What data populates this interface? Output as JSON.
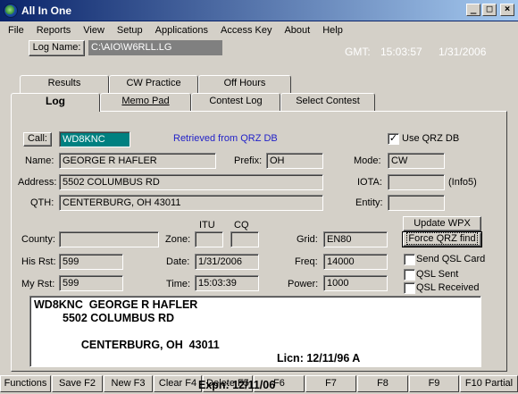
{
  "window": {
    "title": "All In One"
  },
  "menu": [
    "File",
    "Reports",
    "View",
    "Setup",
    "Applications",
    "Access Key",
    "About",
    "Help"
  ],
  "header": {
    "logname_button": "Log Name:",
    "logname_value": "C:\\AIO\\W6RLL.LG",
    "gmt_label": "GMT:",
    "gmt_time": "15:03:57",
    "date": "1/31/2006"
  },
  "tabs_row1": [
    "Results",
    "CW Practice",
    "Off Hours"
  ],
  "tabs_row2": [
    "Log",
    "Memo Pad",
    "Contest Log",
    "Select Contest"
  ],
  "form": {
    "call_button": "Call:",
    "call": "WD8KNC",
    "retrieved": "Retrieved from QRZ DB",
    "use_qrz_label": "Use QRZ DB",
    "use_qrz_checked": "✓",
    "name_label": "Name:",
    "name": "GEORGE R HAFLER",
    "prefix_label": "Prefix:",
    "prefix": "OH",
    "mode_label": "Mode:",
    "mode": "CW",
    "address_label": "Address:",
    "address": "5502 COLUMBUS RD",
    "iota_label": "IOTA:",
    "iota": "",
    "info5": "(Info5)",
    "qth_label": "QTH:",
    "qth": "CENTERBURG, OH  43011",
    "entity_label": "Entity:",
    "entity": "",
    "itu_label": "ITU",
    "cq_label": "CQ",
    "county_label": "County:",
    "county": "",
    "zone_label": "Zone:",
    "itu_zone": "",
    "cq_zone": "",
    "grid_label": "Grid:",
    "grid": "EN80",
    "update_wpx": "Update WPX",
    "force_qrz": "Force QRZ find",
    "his_rst_label": "His Rst:",
    "his_rst": "599",
    "date_label": "Date:",
    "date": "1/31/2006",
    "freq_label": "Freq:",
    "freq": "14000",
    "send_qsl_label": "Send QSL Card",
    "qsl_sent_label": "QSL Sent",
    "my_rst_label": "My Rst:",
    "my_rst": "599",
    "time_label": "Time:",
    "time": "15:03:39",
    "power_label": "Power:",
    "power": "1000",
    "qsl_received_label": "QSL Received"
  },
  "memo": {
    "line1": "WD8KNC  GEORGE R HAFLER",
    "line2": "5502 COLUMBUS RD",
    "line3a": "CENTERBURG, OH  43011",
    "line3b": "Licn: 12/11/96 A",
    "line4": "Expn: 12/11/06"
  },
  "fkeys": [
    "Functions",
    "Save F2",
    "New F3",
    "Clear F4",
    "Delete F5",
    "F6",
    "F7",
    "F8",
    "F9",
    "F10 Partial"
  ]
}
